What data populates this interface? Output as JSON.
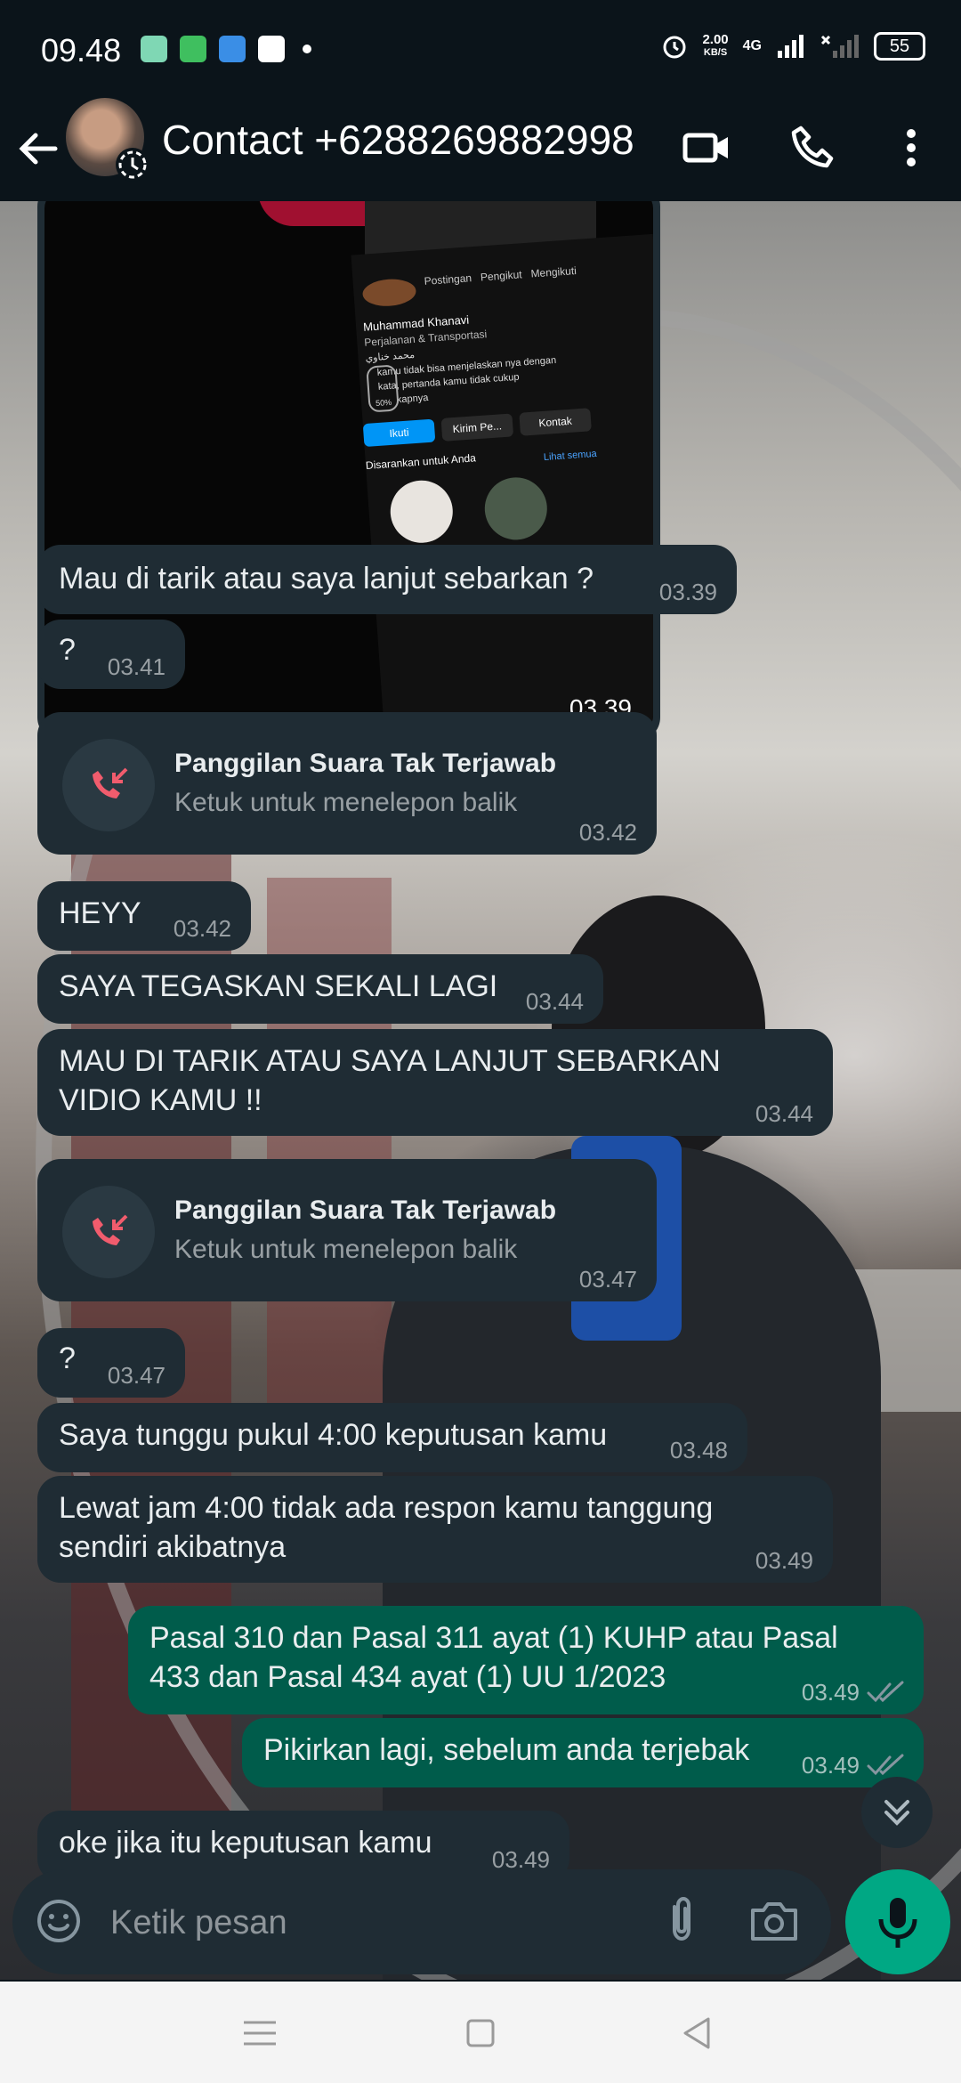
{
  "status_bar": {
    "time": "09.48",
    "speed_value": "2.00",
    "speed_unit": "KB/S",
    "network": "4G",
    "battery": "55"
  },
  "header": {
    "title": "Contact +6288269882998",
    "back_icon": "arrow-left-icon",
    "video_icon": "video-call-icon",
    "call_icon": "phone-icon",
    "menu_icon": "more-vertical-icon"
  },
  "image_message": {
    "time": "03.39",
    "profile_name": "Muhammad Khanavi",
    "profile_category": "Perjalanan & Transportasi",
    "profile_name_local": "محمد خناوي",
    "profile_bio_1": "kamu tidak bisa menjelaskan nya dengan",
    "profile_bio_2": "kata, pertanda kamu tidak cukup",
    "profile_bio_3": "kapnya",
    "stat_posts": "Postingan",
    "stat_followers": "Pengikut",
    "stat_following": "Mengikuti",
    "btn_follow": "Ikuti",
    "btn_message": "Kirim Pe...",
    "btn_contact": "Kontak",
    "suggested": "Disarankan untuk Anda",
    "see_all": "Lihat semua",
    "progress": "50%"
  },
  "messages": [
    {
      "text": "Mau di tarik atau saya lanjut sebarkan ?",
      "time": "03.39"
    },
    {
      "text": "?",
      "time": "03.41"
    },
    {
      "call_title": "Panggilan Suara Tak Terjawab",
      "call_sub": "Ketuk untuk menelepon balik",
      "time": "03.42"
    },
    {
      "text": "HEYY",
      "time": "03.42"
    },
    {
      "text": "SAYA TEGASKAN SEKALI LAGI",
      "time": "03.44"
    },
    {
      "text": "MAU DI TARIK ATAU SAYA LANJUT SEBARKAN VIDIO KAMU !!",
      "time": "03.44"
    },
    {
      "call_title": "Panggilan Suara Tak Terjawab",
      "call_sub": "Ketuk untuk menelepon balik",
      "time": "03.47"
    },
    {
      "text": "?",
      "time": "03.47"
    },
    {
      "text": "Saya tunggu pukul 4:00 keputusan kamu",
      "time": "03.48"
    },
    {
      "text": "Lewat jam 4:00 tidak ada respon kamu tanggung sendiri akibatnya",
      "time": "03.49"
    },
    {
      "text": "Pasal 310 dan Pasal 311 ayat (1) KUHP atau Pasal 433 dan Pasal 434 ayat (1) UU 1/2023",
      "time": "03.49"
    },
    {
      "text": "Pikirkan lagi, sebelum anda terjebak",
      "time": "03.49"
    },
    {
      "text": "oke jika itu keputusan kamu",
      "time": "03.49"
    }
  ],
  "input": {
    "placeholder": "Ketik pesan",
    "emoji_icon": "emoji-icon",
    "attach_icon": "paperclip-icon",
    "camera_icon": "camera-icon",
    "mic_icon": "microphone-icon"
  },
  "colors": {
    "background": "#0b141a",
    "incoming_bubble": "#1f2c34",
    "outgoing_bubble": "#005c4b",
    "accent": "#00a884",
    "missed_call": "#f15c6d",
    "read_ticks": "#8696a0"
  }
}
